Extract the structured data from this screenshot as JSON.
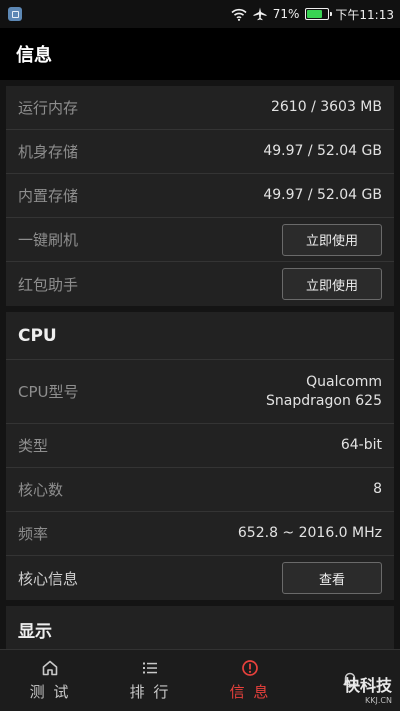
{
  "status_bar": {
    "battery_percent": "71%",
    "battery_level": 0.71,
    "time": "下午11:13",
    "battery_color": "#39d353"
  },
  "header": {
    "title": "信息"
  },
  "storage": {
    "rows": [
      {
        "label": "运行内存",
        "value": "2610 / 3603 MB"
      },
      {
        "label": "机身存储",
        "value": "49.97 / 52.04 GB"
      },
      {
        "label": "内置存储",
        "value": "49.97 / 52.04 GB"
      }
    ],
    "one_key_flash": {
      "label": "一键刷机",
      "button": "立即使用"
    },
    "red_packet": {
      "label": "红包助手",
      "button": "立即使用"
    }
  },
  "cpu": {
    "title": "CPU",
    "model_label": "CPU型号",
    "model_line1": "Qualcomm",
    "model_line2": "Snapdragon 625",
    "type_label": "类型",
    "type_value": "64-bit",
    "cores_label": "核心数",
    "cores_value": "8",
    "freq_label": "频率",
    "freq_value": "652.8 ~ 2016.0 MHz",
    "core_info_label": "核心信息",
    "core_info_button": "查看"
  },
  "display": {
    "title": "显示"
  },
  "nav": {
    "items": [
      {
        "label": "测 试",
        "icon": "home-icon"
      },
      {
        "label": "排 行",
        "icon": "list-icon"
      },
      {
        "label": "信 息",
        "icon": "info-alert-icon",
        "active": true
      },
      {
        "label": "",
        "icon": "bell-icon"
      }
    ],
    "active_color": "#e8413c"
  },
  "watermark": {
    "main": "快科技",
    "sub": "KKJ.CN"
  }
}
